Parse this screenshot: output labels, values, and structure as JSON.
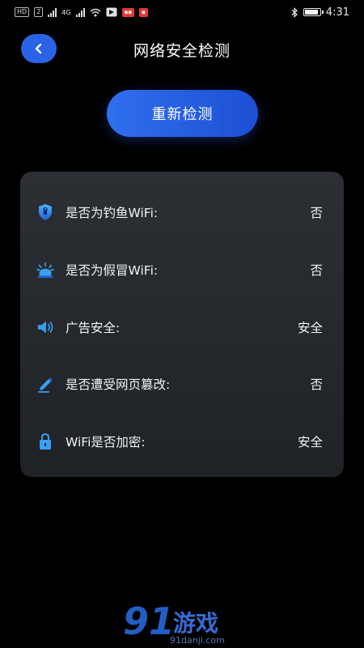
{
  "status_bar": {
    "hd_badge": "HD",
    "sim_badge": "2",
    "network_4g": "4G",
    "time": "4:31"
  },
  "header": {
    "back_icon": "chevron-left-icon",
    "title": "网络安全检测"
  },
  "recheck_button": {
    "label": "重新检测"
  },
  "checks": [
    {
      "icon": "shield-icon",
      "label": "是否为钓鱼WiFi:",
      "value": "否"
    },
    {
      "icon": "alarm-icon",
      "label": "是否为假冒WiFi:",
      "value": "否"
    },
    {
      "icon": "speaker-icon",
      "label": "广告安全:",
      "value": "安全"
    },
    {
      "icon": "pencil-icon",
      "label": "是否遭受网页篡改:",
      "value": "否"
    },
    {
      "icon": "lock-icon",
      "label": "WiFi是否加密:",
      "value": "安全"
    }
  ],
  "watermark": {
    "brand": "91",
    "name": "游戏",
    "url": "91danji.com"
  },
  "colors": {
    "accent": "#2a63e6",
    "background": "#000000",
    "card": "#26292e"
  }
}
